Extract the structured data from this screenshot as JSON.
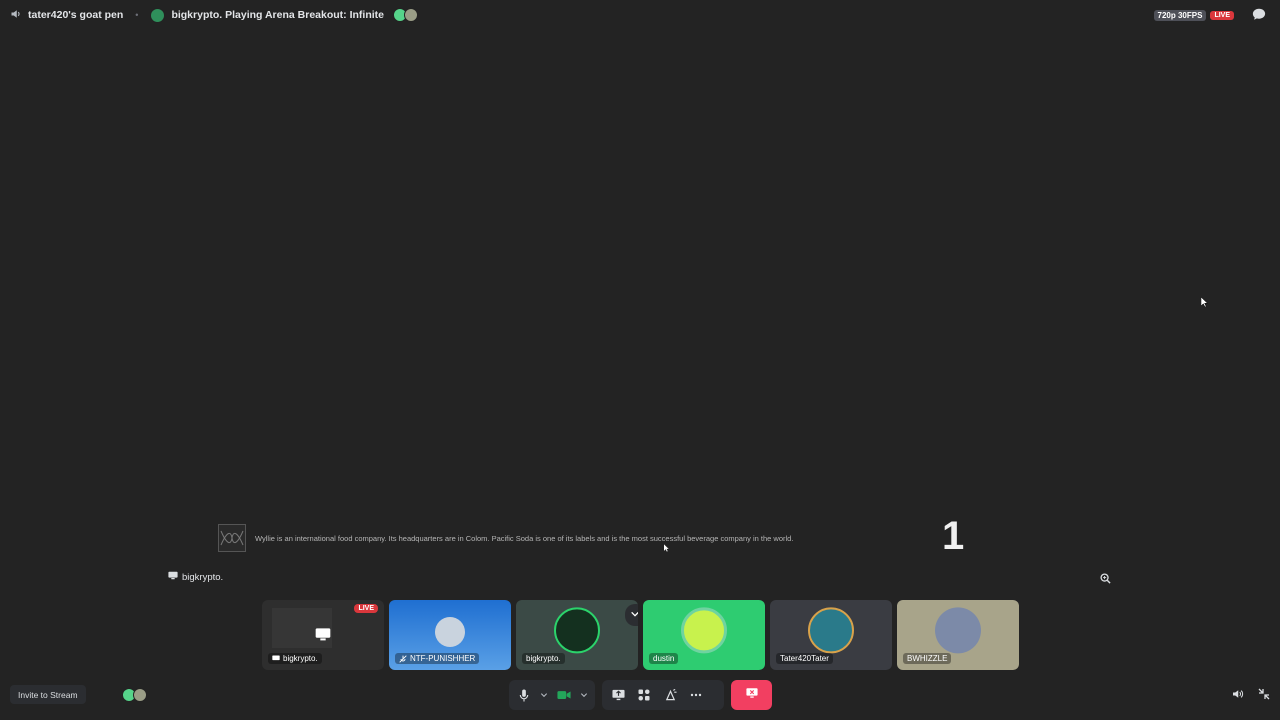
{
  "top": {
    "channel_name": "tater420's goat pen",
    "separator": "•",
    "stream_title": "bigkrypto. Playing Arena Breakout: Infinite",
    "quality": "720p 30FPS",
    "live": "LIVE"
  },
  "caption": {
    "text": "Wyllie is an international food company. Its headquarters are in Colom. Pacific Soda is one of its labels and is the most successful beverage company in the world.",
    "number": "1"
  },
  "streamer_label": "bigkrypto.",
  "tiles": [
    {
      "name": "bigkrypto.",
      "live": "LIVE",
      "bg": "#2e2e2e"
    },
    {
      "name": "NTF-PUNISHHER",
      "bg": "#2f79c9"
    },
    {
      "name": "bigkrypto.",
      "bg": "#3b4a46"
    },
    {
      "name": "dustin",
      "bg": "#2ecc71"
    },
    {
      "name": "Tater420Tater",
      "bg": "#3a3c42"
    },
    {
      "name": "BWHIZZLE",
      "bg": "#a8a48a"
    }
  ],
  "bottom": {
    "invite": "Invite to Stream"
  },
  "colors": {
    "background": "#232323",
    "panel": "#2b2d31",
    "danger": "#f23f61",
    "live": "#da373c",
    "green": "#2ecc71"
  }
}
